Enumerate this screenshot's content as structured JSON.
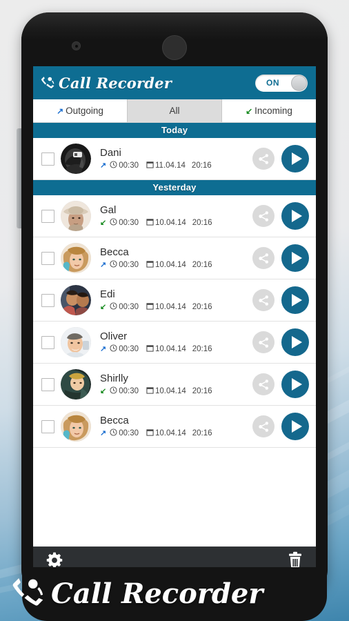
{
  "app": {
    "name": "Call Recorder",
    "brand_icon": "phone-handset-icon",
    "header_color": "#0e6d92",
    "accent_color": "#14688d"
  },
  "header": {
    "title": "Call Recorder",
    "toggle": {
      "label": "ON",
      "state": "on"
    }
  },
  "tabs": [
    {
      "label": "Outgoing",
      "icon": "arrow-out-icon",
      "direction": "outgoing",
      "selected": false
    },
    {
      "label": "All",
      "icon": "",
      "direction": "all",
      "selected": true
    },
    {
      "label": "Incoming",
      "icon": "arrow-in-icon",
      "direction": "incoming",
      "selected": false
    }
  ],
  "sections": [
    {
      "title": "Today",
      "rows": [
        {
          "name": "Dani",
          "direction": "outgoing",
          "duration": "00:30",
          "date": "11.04.14",
          "time": "20:16",
          "checked": false,
          "avatar": "dani-avatar"
        }
      ]
    },
    {
      "title": "Yesterday",
      "rows": [
        {
          "name": "Gal",
          "direction": "incoming",
          "duration": "00:30",
          "date": "10.04.14",
          "time": "20:16",
          "checked": false,
          "avatar": "gal-avatar"
        },
        {
          "name": "Becca",
          "direction": "outgoing",
          "duration": "00:30",
          "date": "10.04.14",
          "time": "20:16",
          "checked": false,
          "avatar": "becca-avatar"
        },
        {
          "name": "Edi",
          "direction": "incoming",
          "duration": "00:30",
          "date": "10.04.14",
          "time": "20:16",
          "checked": false,
          "avatar": "edi-avatar"
        },
        {
          "name": "Oliver",
          "direction": "outgoing",
          "duration": "00:30",
          "date": "10.04.14",
          "time": "20:16",
          "checked": false,
          "avatar": "oliver-avatar"
        },
        {
          "name": "Shirlly",
          "direction": "incoming",
          "duration": "00:30",
          "date": "10.04.14",
          "time": "20:16",
          "checked": false,
          "avatar": "shirlly-avatar"
        },
        {
          "name": "Becca",
          "direction": "outgoing",
          "duration": "00:30",
          "date": "10.04.14",
          "time": "20:16",
          "checked": false,
          "avatar": "becca2-avatar"
        }
      ]
    }
  ],
  "row_icons": {
    "share": "share-icon",
    "play": "play-icon",
    "duration": "clock-icon",
    "date": "calendar-icon",
    "outgoing_arrow": "↗",
    "incoming_arrow": "↙"
  },
  "action_bar": {
    "settings_label": "Settings",
    "settings_icon": "gear-icon",
    "delete_label": "Delete",
    "delete_icon": "trash-icon"
  },
  "footer_brand": {
    "title": "Call Recorder",
    "icon": "phone-handset-icon"
  }
}
